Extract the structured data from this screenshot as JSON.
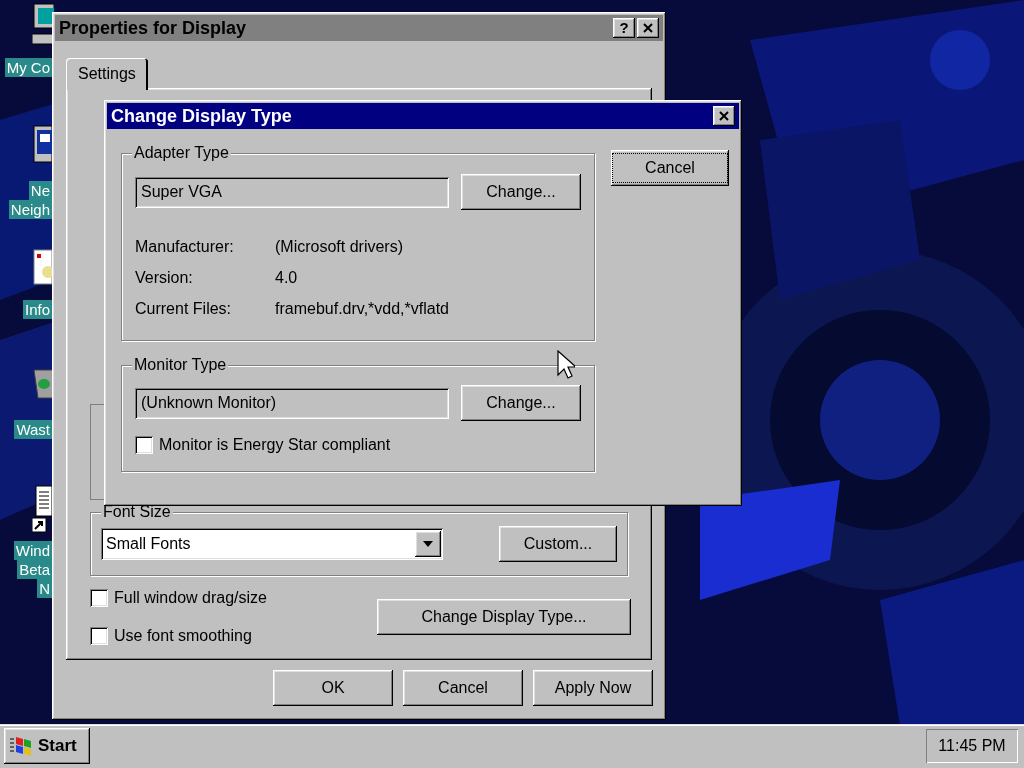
{
  "desktop": {
    "icons": [
      {
        "kind": "computer",
        "lines": [
          "My Co"
        ]
      },
      {
        "kind": "network",
        "lines": [
          "Ne",
          "Neigh"
        ]
      },
      {
        "kind": "info",
        "lines": [
          "Info"
        ]
      },
      {
        "kind": "wastebasket",
        "lines": [
          "Wast"
        ]
      },
      {
        "kind": "shortcut",
        "lines": [
          "Wind",
          "Beta",
          "N"
        ]
      }
    ]
  },
  "properties_window": {
    "title": "Properties for Display",
    "active": false,
    "help_button": "?",
    "tabs": [
      {
        "label": "Settings",
        "selected": true
      }
    ],
    "font_size": {
      "label": "Font Size",
      "value": "Small Fonts",
      "button": "Custom..."
    },
    "checkboxes": [
      {
        "label": "Full window drag/size",
        "checked": false
      },
      {
        "label": "Use font smoothing",
        "checked": false
      }
    ],
    "change_display_type_button": "Change Display Type...",
    "buttons": [
      "OK",
      "Cancel",
      "Apply Now"
    ]
  },
  "dialog": {
    "title": "Change Display Type",
    "active": true,
    "adapter": {
      "label": "Adapter Type",
      "value": "Super VGA",
      "button": "Change...",
      "details": [
        {
          "label": "Manufacturer:",
          "value": "(Microsoft drivers)"
        },
        {
          "label": "Version:",
          "value": "4.0"
        },
        {
          "label": "Current Files:",
          "value": "framebuf.drv,*vdd,*vflatd"
        }
      ]
    },
    "monitor": {
      "label": "Monitor Type",
      "value": "(Unknown Monitor)",
      "button": "Change...",
      "checkbox": {
        "label": "Monitor is Energy Star compliant",
        "checked": false
      }
    },
    "cancel_button": {
      "label": "Cancel",
      "focused": true
    }
  },
  "taskbar": {
    "start": "Start",
    "clock": "11:45 PM"
  }
}
